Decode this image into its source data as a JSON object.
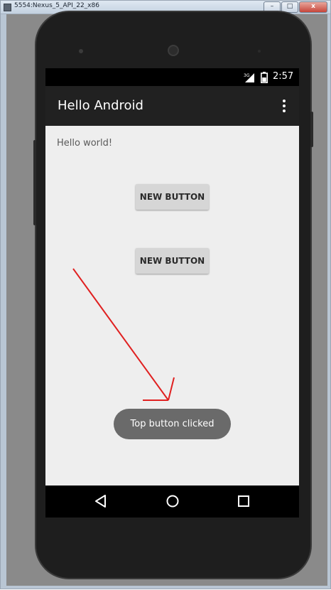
{
  "window": {
    "title": "5554:Nexus_5_API_22_x86",
    "controls": {
      "minimize": "–",
      "maximize": "□",
      "close": "x"
    }
  },
  "status_bar": {
    "network_label": "3G",
    "time": "2:57"
  },
  "action_bar": {
    "title": "Hello Android",
    "overflow_icon": "more-vert-icon"
  },
  "content": {
    "hello_text": "Hello world!",
    "buttons": [
      {
        "label": "NEW BUTTON"
      },
      {
        "label": "NEW BUTTON"
      }
    ],
    "toast": "Top button clicked"
  },
  "navigation": {
    "back_icon": "back-triangle-icon",
    "home_icon": "home-circle-icon",
    "recents_icon": "recents-square-icon"
  },
  "colors": {
    "annotation_arrow": "#e02020",
    "action_bar": "#212121",
    "content_background": "#eeeeee",
    "toast_background": "#6a6a6a",
    "button_background": "#d6d6d6"
  }
}
